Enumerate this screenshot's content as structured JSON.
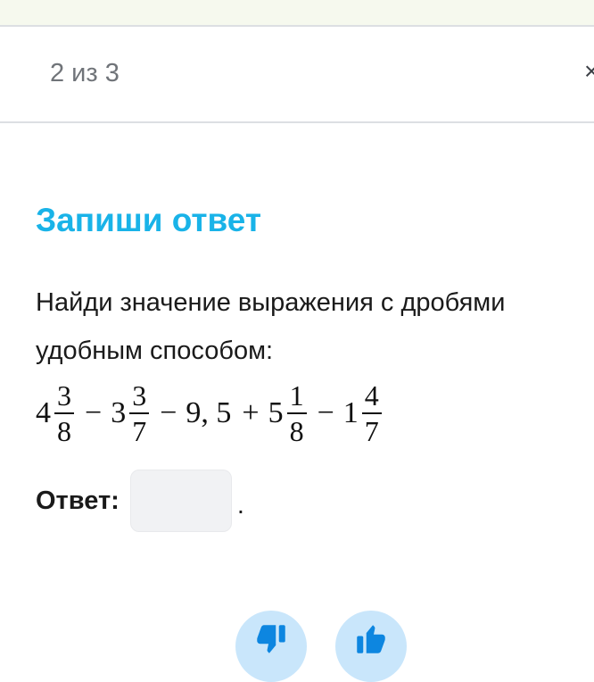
{
  "header": {
    "progress": "2 из 3",
    "close_glyph": "×"
  },
  "task": {
    "title": "Запиши ответ",
    "text": "Найди значение выражения с дробями удобным способом:",
    "expression": {
      "parts": [
        {
          "whole": "4",
          "num": "3",
          "den": "8"
        },
        {
          "op": "−"
        },
        {
          "whole": "3",
          "num": "3",
          "den": "7"
        },
        {
          "op": "−"
        },
        {
          "value": "9, 5"
        },
        {
          "op": "+"
        },
        {
          "whole": "5",
          "num": "1",
          "den": "8"
        },
        {
          "op": "−"
        },
        {
          "whole": "1",
          "num": "4",
          "den": "7"
        }
      ]
    },
    "answer_label": "Ответ:",
    "answer_value": "",
    "answer_suffix": "."
  },
  "rating": {
    "dislike_icon": "thumbs-down-icon",
    "like_icon": "thumbs-up-icon",
    "accent_color": "#c9e6fb",
    "icon_color": "#0d86e0"
  },
  "colors": {
    "title": "#19b3e8"
  }
}
